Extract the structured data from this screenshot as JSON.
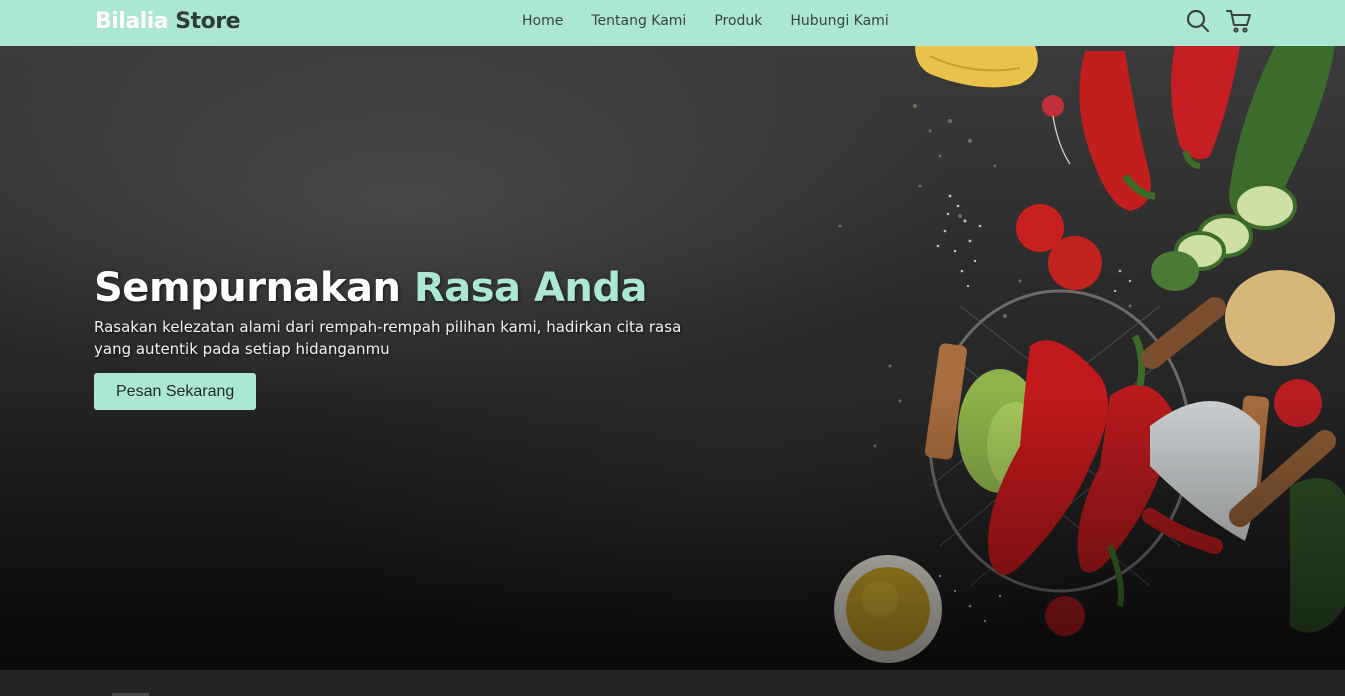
{
  "brand": {
    "first": "Bilalia",
    "second": " Store"
  },
  "nav": {
    "links": [
      "Home",
      "Tentang Kami",
      "Produk",
      "Hubungi Kami"
    ],
    "icons": [
      "search-icon",
      "cart-icon"
    ]
  },
  "hero": {
    "title_main": "Sempurnakan ",
    "title_accent": "Rasa Anda",
    "description": "Rasakan kelezatan alami dari rempah-rempah pilihan kami, hadirkan cita rasa yang autentik pada setiap hidanganmu",
    "cta_label": "Pesan Sekarang"
  },
  "colors": {
    "accent": "#abe7d3",
    "navbar_bg": "#abe7d3",
    "hero_bg": "#2a2a2a",
    "footer_bg": "#242424"
  }
}
